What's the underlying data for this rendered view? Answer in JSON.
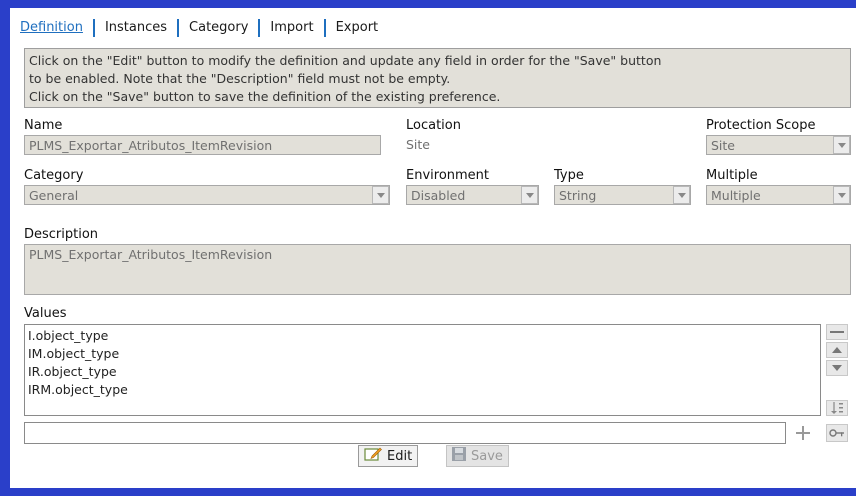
{
  "tabs": [
    {
      "label": "Definition"
    },
    {
      "label": "Instances"
    },
    {
      "label": "Category"
    },
    {
      "label": "Import"
    },
    {
      "label": "Export"
    }
  ],
  "info": {
    "line1": "Click on the \"Edit\" button to modify the definition and update any field in order for the \"Save\" button",
    "line2": "to be enabled. Note that the \"Description\" field must not be empty.",
    "line3": "Click on the \"Save\" button to save the definition of the existing preference."
  },
  "name": {
    "label": "Name",
    "value": "PLMS_Exportar_Atributos_ItemRevision"
  },
  "location": {
    "label": "Location",
    "value": "Site"
  },
  "protection_scope": {
    "label": "Protection Scope",
    "value": "Site"
  },
  "category": {
    "label": "Category",
    "value": "General"
  },
  "environment": {
    "label": "Environment",
    "value": "Disabled"
  },
  "type": {
    "label": "Type",
    "value": "String"
  },
  "multiple": {
    "label": "Multiple",
    "value": "Multiple"
  },
  "description": {
    "label": "Description",
    "value": "PLMS_Exportar_Atributos_ItemRevision"
  },
  "values": {
    "label": "Values",
    "items": [
      "I.object_type",
      "IM.object_type",
      "IR.object_type",
      "IRM.object_type"
    ],
    "new_value": ""
  },
  "buttons": {
    "edit": "Edit",
    "save": "Save"
  },
  "icons": {
    "remove": "minus-icon",
    "up": "arrow-up-icon",
    "down": "arrow-down-icon",
    "sort": "sort-icon",
    "add": "plus-icon",
    "key": "key-icon"
  },
  "colors": {
    "accent": "#1f6fbf",
    "frame": "#2a3fc9",
    "readonly_bg": "#e2e0d9"
  }
}
